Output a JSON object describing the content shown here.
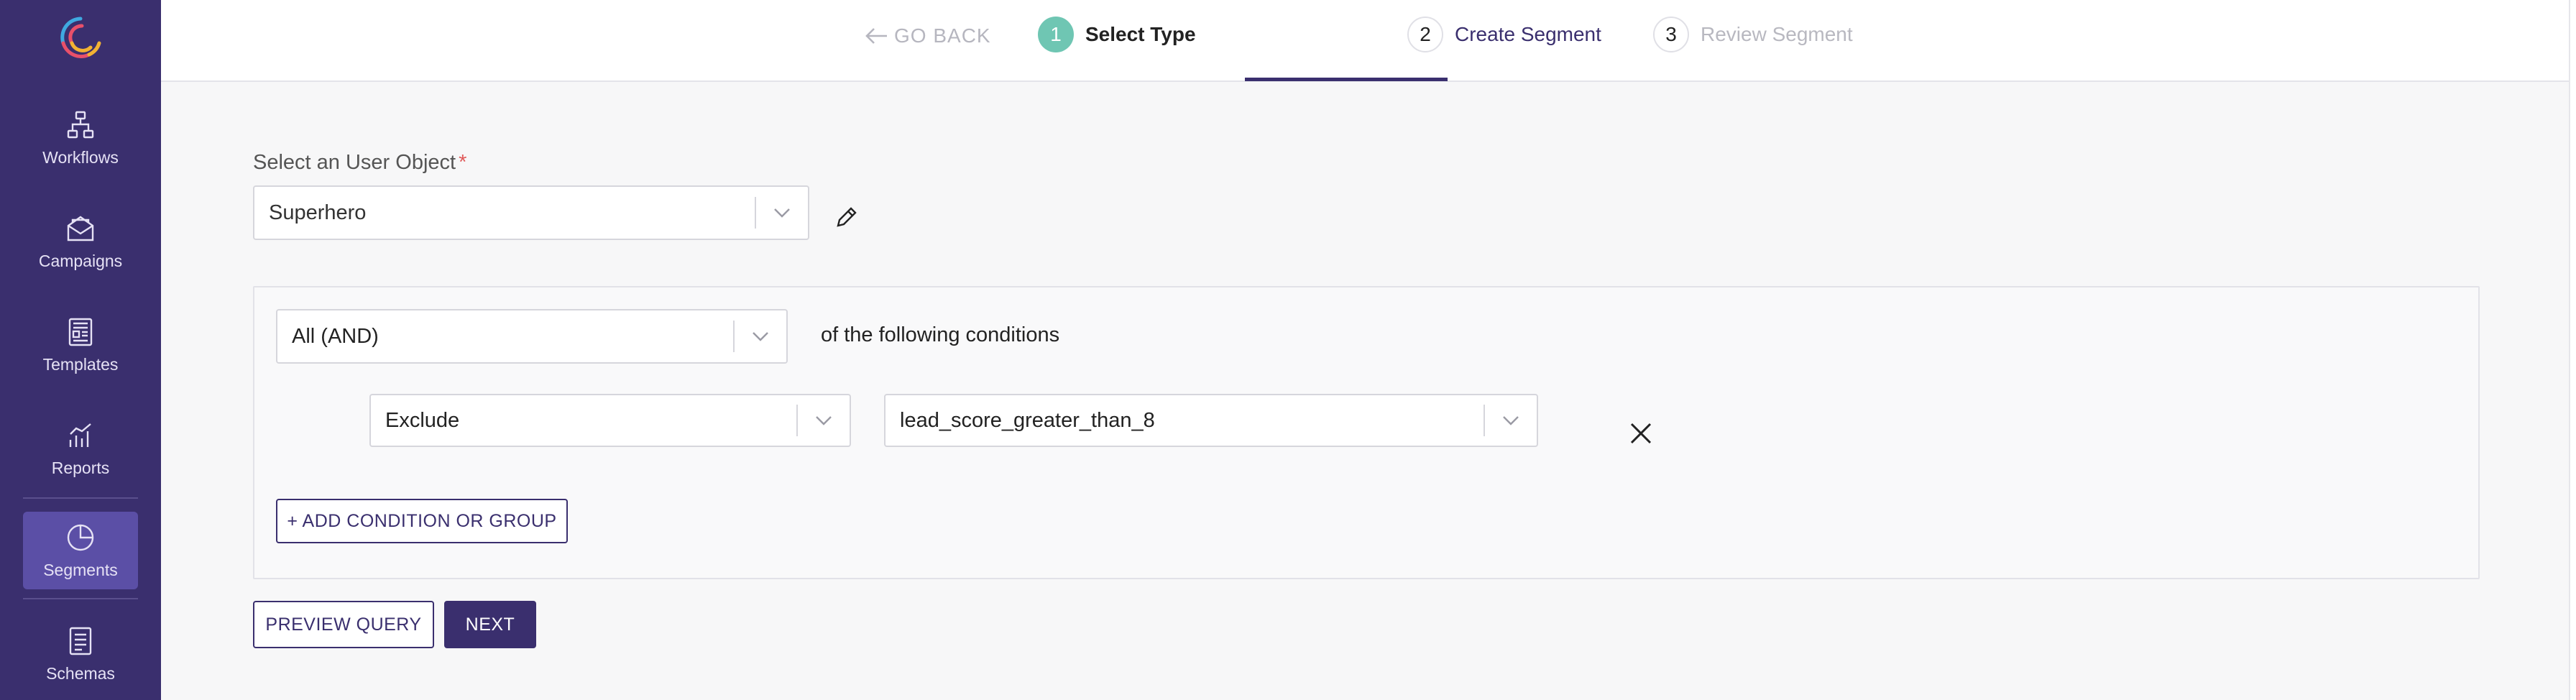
{
  "sidebar": {
    "items": [
      {
        "label": "Workflows",
        "icon": "workflow-icon"
      },
      {
        "label": "Campaigns",
        "icon": "mail-icon"
      },
      {
        "label": "Templates",
        "icon": "template-icon"
      },
      {
        "label": "Reports",
        "icon": "chart-icon"
      },
      {
        "label": "Segments",
        "icon": "pie-chart-icon",
        "active": true
      },
      {
        "label": "Schemas",
        "icon": "document-icon"
      }
    ]
  },
  "stepper": {
    "go_back": "GO BACK",
    "steps": [
      {
        "number": "1",
        "label": "Select Type"
      },
      {
        "number": "2",
        "label": "Create Segment"
      },
      {
        "number": "3",
        "label": "Review Segment"
      }
    ]
  },
  "form": {
    "user_object_label": "Select an User Object",
    "required_marker": "*",
    "user_object_value": "Superhero",
    "match_value": "All (AND)",
    "match_suffix": "of the following conditions",
    "condition": {
      "mode_value": "Exclude",
      "segment_value": "lead_score_greater_than_8"
    },
    "add_condition_label": "+ ADD CONDITION OR GROUP",
    "preview_label": "PREVIEW QUERY",
    "next_label": "NEXT"
  },
  "colors": {
    "sidebar_bg": "#3a2f6e",
    "sidebar_active": "#5b4fa6",
    "primary": "#3a2f6e",
    "step_done": "#6fc6b3",
    "required": "#e05a5a"
  }
}
